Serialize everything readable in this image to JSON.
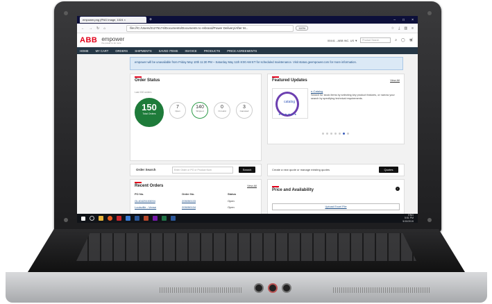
{
  "browser": {
    "tab_title": "empower.png (PNG Image, 1024 ×",
    "new_tab": "+",
    "window_controls": [
      "–",
      "□",
      "×"
    ],
    "url": "file:///C:/Users/21275174/Documents/Documents to rebrand/Power Delivery/After M...",
    "zoom": "110%",
    "nav_icons": [
      "back-arrow-icon",
      "forward-arrow-icon",
      "reload-icon",
      "home-icon"
    ]
  },
  "header": {
    "logo": "ABB",
    "brand": "empower",
    "tagline": "the power to do more",
    "account": "00441 - ABB INC. US ▼",
    "search_placeholder": "Product Search",
    "cart_count": "0"
  },
  "nav": {
    "items": [
      "HOME",
      "MY CART",
      "ORDERS",
      "SHIPMENTS",
      "SAVED ITEMS",
      "INVOICE",
      "PRODUCTS",
      "PRICE AGREEMENTS"
    ]
  },
  "banner": {
    "text": "empower will be unavailable from Friday May 10th 11:30 PM – Saturday May 11th 8:00 AM ET for scheduled maintenance. Visit status.geempower.com for more information."
  },
  "order_status": {
    "title": "Order Status",
    "subtitle": "Last 150 orders",
    "total": {
      "value": "150",
      "label": "Total Orders"
    },
    "stats": [
      {
        "value": "7",
        "label": "Open"
      },
      {
        "value": "140",
        "label": "Shipped"
      },
      {
        "value": "0",
        "label": "On Hold"
      },
      {
        "value": "3",
        "label": "Canceled"
      }
    ]
  },
  "featured": {
    "title": "Featured Updates",
    "view_all": "View All",
    "item_title": "e-Catalog",
    "item_text": "Search for stock items by selecting key product features, or narrow your search by specifying technical requirements.",
    "logo_text": "catalog"
  },
  "order_search": {
    "label": "Order Search",
    "placeholder": "Enter Order or PO or Product Num",
    "button": "Search"
  },
  "quotes": {
    "text": "Create a new quote or manage existing quotes",
    "button": "Quotes"
  },
  "recent_orders": {
    "title": "Recent Orders",
    "view_all": "View All",
    "headers": [
      "PO No.",
      "Order No.",
      "Status"
    ],
    "rows": [
      [
        "GL40425153094",
        "205050103",
        "Open"
      ],
      [
        "Louisville - Vense",
        "205050104",
        "Open"
      ]
    ]
  },
  "price_availability": {
    "title": "Price and Availability",
    "upload": "Upload Excel File",
    "copy_paste": "Copy & Paste"
  },
  "taskbar": {
    "time": "5:51 PM",
    "date": "5/10/2019",
    "lang": "ENG"
  }
}
